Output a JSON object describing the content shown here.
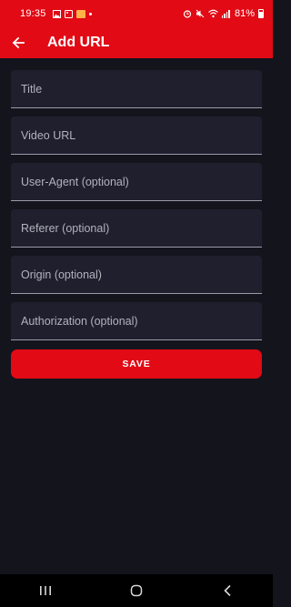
{
  "status_bar": {
    "time": "19:35",
    "battery_percent": "81%",
    "icons": [
      "gallery-icon",
      "image-icon",
      "app-notification-icon",
      "dot-icon",
      "alarm-icon",
      "mute-icon",
      "wifi-icon",
      "signal-icon",
      "battery-icon"
    ]
  },
  "toolbar": {
    "title": "Add URL",
    "back_icon": "arrow-left-icon"
  },
  "form": {
    "fields": [
      {
        "placeholder": "Title",
        "value": ""
      },
      {
        "placeholder": "Video URL",
        "value": ""
      },
      {
        "placeholder": "User-Agent (optional)",
        "value": ""
      },
      {
        "placeholder": "Referer (optional)",
        "value": ""
      },
      {
        "placeholder": "Origin (optional)",
        "value": ""
      },
      {
        "placeholder": "Authorization (optional)",
        "value": ""
      }
    ],
    "save_label": "SAVE"
  },
  "nav_bar": {
    "buttons": [
      "recents-icon",
      "home-icon",
      "back-icon"
    ]
  },
  "colors": {
    "accent": "#e10a15",
    "background": "#14141d",
    "field": "#1f1f2e",
    "placeholder": "#b3b3bd"
  }
}
